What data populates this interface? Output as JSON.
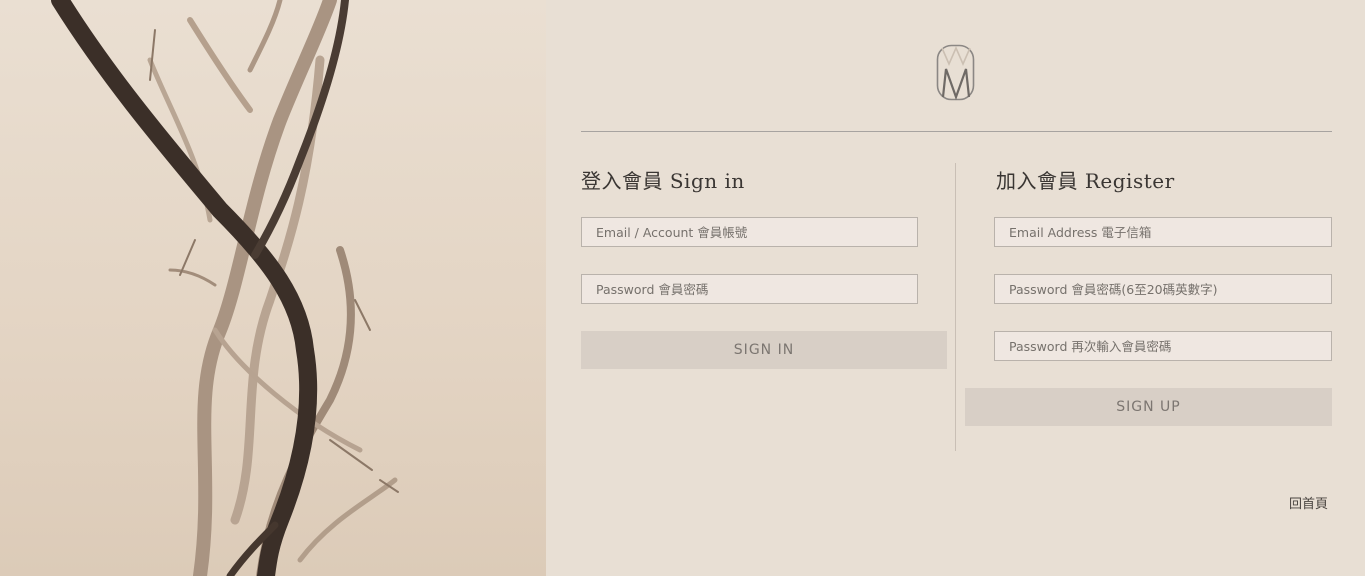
{
  "hero": {
    "image": "dry-branch-photo"
  },
  "logo": {
    "icon": "monogram-m-logo"
  },
  "signin": {
    "title": "登入會員 Sign in",
    "account_placeholder": "Email / Account 會員帳號",
    "password_placeholder": "Password 會員密碼",
    "button_label": "SIGN IN"
  },
  "register": {
    "title": "加入會員 Register",
    "email_placeholder": "Email Address 電子信箱",
    "password_placeholder": "Password 會員密碼(6至20碼英數字)",
    "confirm_placeholder": "Password 再次輸入會員密碼",
    "button_label": "SIGN UP"
  },
  "footer": {
    "home_link": "回首頁"
  },
  "colors": {
    "panel_bg": "#e8dfd4",
    "field_bg": "#efe7e1",
    "button_bg": "#d8cfc6",
    "button_text": "#7c7671"
  }
}
